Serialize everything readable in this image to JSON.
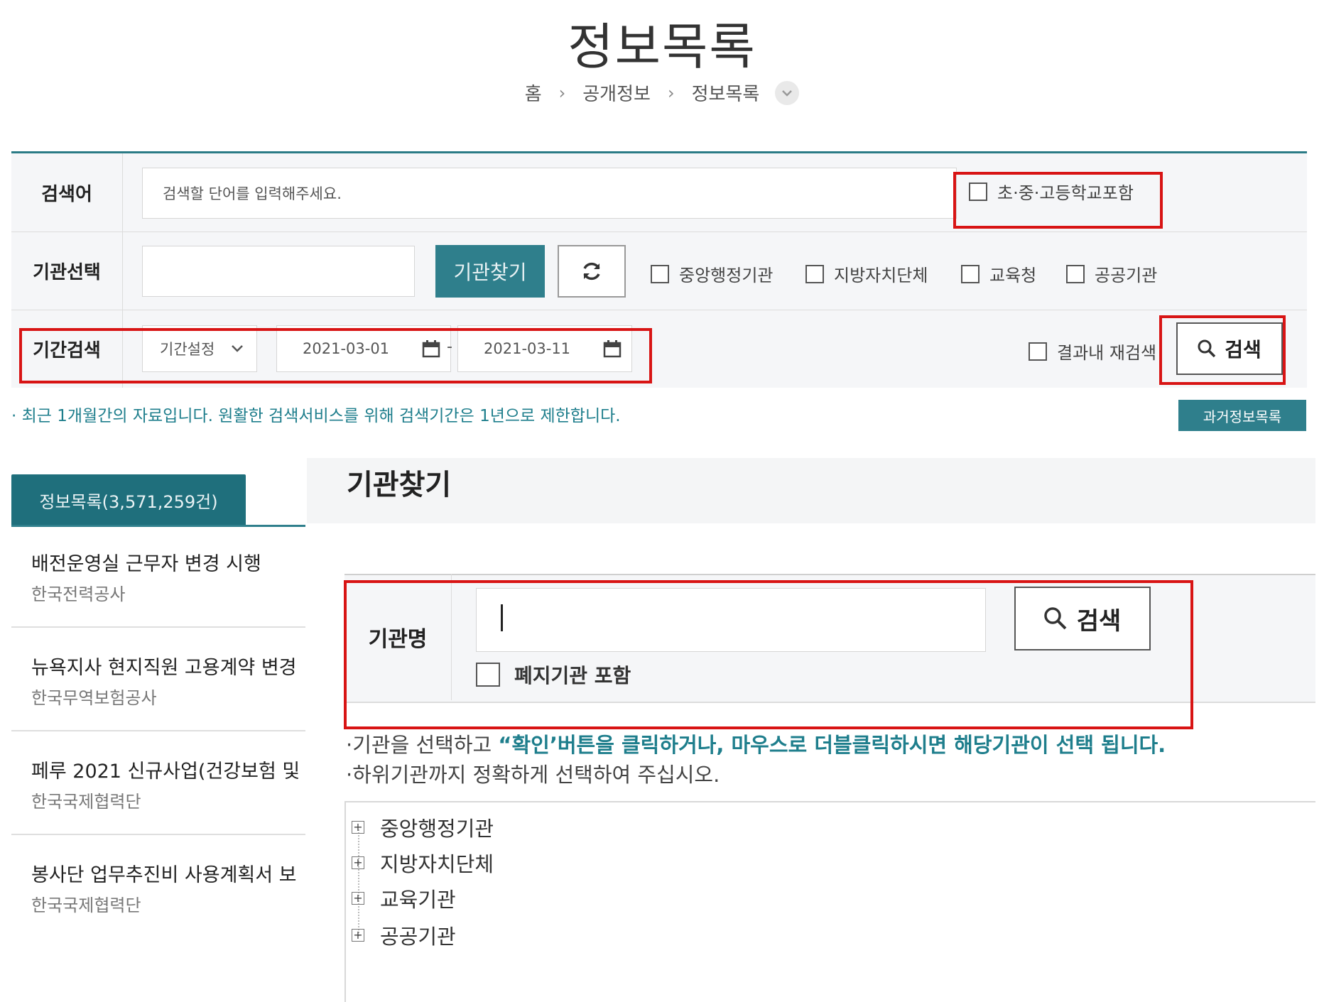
{
  "page": {
    "title": "정보목록",
    "breadcrumb": [
      "홈",
      "공개정보",
      "정보목록"
    ],
    "breadcrumb_sep": "›",
    "breadcrumb_dropdown_icon": "chevron-down-icon"
  },
  "search": {
    "keyword_label": "검색어",
    "keyword_placeholder": "검색할 단어를 입력해주세요.",
    "include_schools_label": "초·중·고등학교포함",
    "agency_label": "기관선택",
    "agency_find_button": "기관찾기",
    "refresh_icon": "refresh-icon",
    "agency_types": [
      "중앙행정기관",
      "지방자치단체",
      "교육청",
      "공공기관"
    ],
    "period_label": "기간검색",
    "period_select": "기간설정",
    "start_date": "2021-03-01",
    "end_date": "2021-03-11",
    "date_separator": "-",
    "within_results_label": "결과내 재검색",
    "search_button": "검색"
  },
  "notice": "· 최근 1개월간의 자료입니다. 원활한 검색서비스를 위해 검색기간은 1년으로 제한합니다.",
  "past_button": "과거정보목록",
  "list": {
    "tab_label": "정보목록(3,571,259건)",
    "items": [
      {
        "title": "배전운영실 근무자 변경 시행",
        "org": "한국전력공사"
      },
      {
        "title": "뉴욕지사 현지직원 고용계약 변경",
        "org": "한국무역보험공사"
      },
      {
        "title": "페루 2021 신규사업(건강보험 및",
        "org": "한국국제협력단"
      },
      {
        "title": "봉사단 업무추진비 사용계획서 보",
        "org": "한국국제협력단"
      }
    ]
  },
  "modal": {
    "title": "기관찾기",
    "name_label": "기관명",
    "name_value": "",
    "search_button": "검색",
    "include_abolished_label": "폐지기관 포함",
    "info_line1_prefix": "·기관을 선택하고 ",
    "info_line1_highlight": "“확인’버튼을 클릭하거나, 마우스로 더블클릭하시면 해당기관이 선택 됩니다.",
    "info_line2": "·하위기관까지 정확하게 선택하여 주십시오.",
    "tree": [
      "중앙행정기관",
      "지방자치단체",
      "교육기관",
      "공공기관"
    ],
    "tree_expand_glyph": "+"
  },
  "colors": {
    "accent": "#2f7f8c",
    "highlight_box": "#d81414"
  }
}
